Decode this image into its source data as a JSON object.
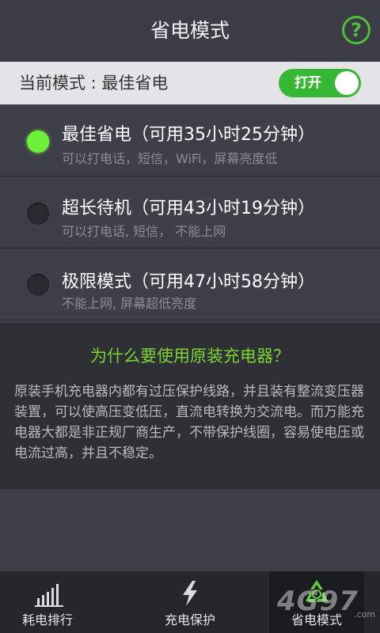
{
  "header": {
    "title": "省电模式",
    "help_label": "?"
  },
  "mode_bar": {
    "label": "当前模式 : 最佳省电",
    "toggle_label": "打开"
  },
  "options": [
    {
      "title": "最佳省电（可用35小时25分钟）",
      "desc": "可以打电话，短信，WiFi，屏幕亮度低",
      "selected": true
    },
    {
      "title": "超长待机（可用43小时19分钟）",
      "desc": "可以打电话, 短信， 不能上网",
      "selected": false
    },
    {
      "title": "极限模式（可用47小时58分钟）",
      "desc": "不能上网, 屏幕超低亮度",
      "selected": false
    }
  ],
  "info": {
    "title": "为什么要使用原装充电器？",
    "body": "原装手机充电器内都有过压保护线路，并且装有整流变压器装置，可以使高压变低压，直流电转换为交流电。而万能充电器大都是非正规厂商生产，不带保护线圈，容易使电压或电流过高，并且不稳定。"
  },
  "nav": [
    {
      "label": "耗电排行",
      "icon": "bar-chart-icon"
    },
    {
      "label": "充电保护",
      "icon": "lightning-icon"
    },
    {
      "label": "省电模式",
      "icon": "recycle-icon"
    }
  ],
  "watermark": {
    "text": "4G97",
    "suffix": ".com"
  },
  "colors": {
    "accent": "#37b834",
    "highlight": "#6cf03a",
    "info_title": "#7bd32e"
  }
}
